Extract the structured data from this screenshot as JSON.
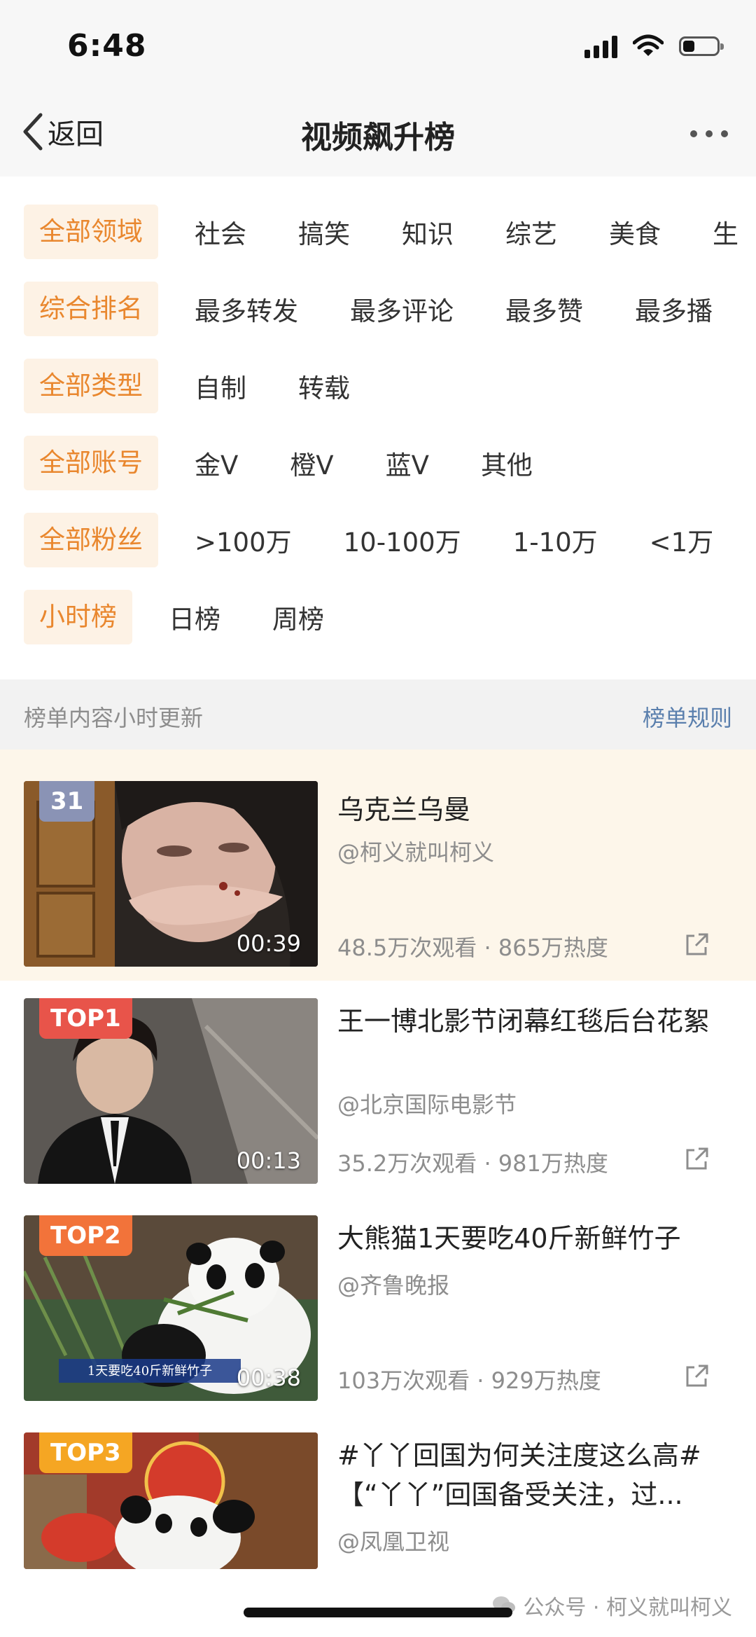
{
  "status_bar": {
    "time": "6:48"
  },
  "nav": {
    "back_label": "返回",
    "title": "视频飙升榜"
  },
  "filters": [
    {
      "selected": "全部领域",
      "options": [
        "社会",
        "搞笑",
        "知识",
        "综艺",
        "美食",
        "生"
      ]
    },
    {
      "selected": "综合排名",
      "options": [
        "最多转发",
        "最多评论",
        "最多赞",
        "最多播"
      ]
    },
    {
      "selected": "全部类型",
      "options": [
        "自制",
        "转载"
      ]
    },
    {
      "selected": "全部账号",
      "options": [
        "金V",
        "橙V",
        "蓝V",
        "其他"
      ]
    },
    {
      "selected": "全部粉丝",
      "options": [
        ">100万",
        "10-100万",
        "1-10万",
        "<1万"
      ]
    },
    {
      "selected": "小时榜",
      "options": [
        "日榜",
        "周榜"
      ]
    }
  ],
  "info_bar": {
    "text": "榜单内容小时更新",
    "rules_label": "榜单规则"
  },
  "videos": [
    {
      "badge": "31",
      "duration": "00:39",
      "title": "乌克兰乌曼",
      "author": "@柯义就叫柯义",
      "views": "48.5万次观看",
      "heat": "865万热度"
    },
    {
      "badge": "TOP1",
      "duration": "00:13",
      "title": "王一博北影节闭幕红毯后台花絮",
      "author": "@北京国际电影节",
      "views": "35.2万次观看",
      "heat": "981万热度"
    },
    {
      "badge": "TOP2",
      "duration": "00:38",
      "title": "大熊猫1天要吃40斤新鲜竹子",
      "thumb_caption": "1天要吃40斤新鲜竹子",
      "author": "@齐鲁晚报",
      "views": "103万次观看",
      "heat": "929万热度"
    },
    {
      "badge": "TOP3",
      "duration": "",
      "title": "#丫丫回国为何关注度这么高#【“丫丫”回国备受关注，过...",
      "author": "@凤凰卫视",
      "views": "",
      "heat": ""
    }
  ],
  "watermark": "公众号 · 柯义就叫柯义",
  "colors": {
    "accent": "#e9872e",
    "accent_bg": "#fdf2e5",
    "link": "#5a7fad",
    "top1": "#e8544a",
    "top2": "#f2733a",
    "top3": "#f5a623",
    "rank_badge": "#8a93b5",
    "highlight_row": "#fdf6ea"
  },
  "icons": [
    "back-chevron-icon",
    "more-dots-icon",
    "share-icon",
    "signal-icon",
    "wifi-icon",
    "battery-icon",
    "wechat-icon"
  ]
}
